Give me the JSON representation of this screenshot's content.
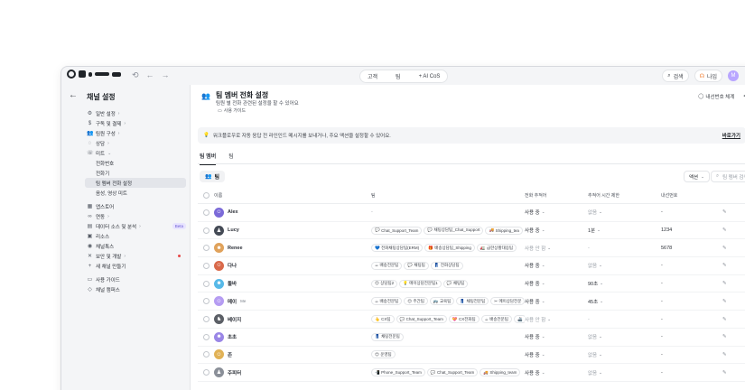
{
  "topbar": {
    "center_tabs": [
      "고객",
      "팀",
      "+ AI CoS"
    ],
    "search_label": "검색",
    "status_label": "나임",
    "avatar_letter": "M"
  },
  "sidebar": {
    "title": "채널 설정",
    "items": [
      {
        "label": "일반 설정",
        "icon": "gear-icon",
        "arrow": true,
        "sub": false
      },
      {
        "label": "구독 및 결제",
        "icon": "dollar-icon",
        "arrow": true,
        "sub": false
      },
      {
        "label": "팀원 구성",
        "icon": "people-icon",
        "arrow": true,
        "sub": false
      },
      {
        "label": "상담",
        "icon": "chat-icon",
        "arrow": true,
        "sub": false
      },
      {
        "label": "미트",
        "icon": "phone-icon",
        "arrow": true,
        "sub": false,
        "open": true
      },
      {
        "label": "전화번호",
        "sub": true
      },
      {
        "label": "전화기",
        "sub": true
      },
      {
        "label": "팀 멤버 전화 설정",
        "sub": true,
        "active": true
      },
      {
        "label": "음성, 영상 미트",
        "sub": true
      }
    ],
    "items2": [
      {
        "label": "앱스토어",
        "icon": "grid-icon",
        "arrow": false
      },
      {
        "label": "연동",
        "icon": "link-icon",
        "arrow": true
      },
      {
        "label": "데이터 소스 및 분석",
        "icon": "chart-icon",
        "arrow": true,
        "beta": "Beta"
      },
      {
        "label": "리소스",
        "icon": "box-icon",
        "arrow": false
      },
      {
        "label": "채널톡스",
        "icon": "circle-icon",
        "arrow": false
      },
      {
        "label": "보안 및 개발",
        "icon": "tools-icon",
        "arrow": true,
        "dot": true
      },
      {
        "label": "새 채널 만들기",
        "icon": "plus-icon",
        "arrow": false
      }
    ],
    "items3": [
      {
        "label": "사용 가이드",
        "icon": "book-icon"
      },
      {
        "label": "채널 캠퍼스",
        "icon": "cap-icon"
      }
    ]
  },
  "header": {
    "title": "팀 멤버 전화 설정",
    "subtitle": "팀원 별 전화 관련된 설정을 할 수 있어요",
    "guide": "사용 가이드",
    "right_label": "내선번호 체계"
  },
  "notice": {
    "text": "워크플로우로 자동 응답 전 라인인드 메시지를 보내거나, 주요 액션을 설정할 수 있어요.",
    "link": "바로가기"
  },
  "tabs": [
    "팀 멤버",
    "팀"
  ],
  "toolbar": {
    "team_button": "팀",
    "action_button": "액션",
    "search_placeholder": "팀 멤버 검색"
  },
  "table": {
    "headers": [
      "이름",
      "팀",
      "전화 추적어",
      "추적어 시간 제한",
      "내선번호"
    ],
    "rows": [
      {
        "name": "Alex",
        "me": "",
        "avatar_color": "#7b6ad8",
        "avatar_glyph": "☺",
        "teams": [],
        "teams_empty": "-",
        "status": "사용 중",
        "status_muted": false,
        "limit": "없음",
        "limit_muted": true,
        "ext": "-"
      },
      {
        "name": "Lucy",
        "me": "",
        "avatar_color": "#444a55",
        "avatar_glyph": "♟",
        "teams": [
          {
            "icon": "💬",
            "label": "Chat_Support_Team"
          },
          {
            "icon": "💬",
            "label": "채팅상담팀_Chat_Support"
          },
          {
            "icon": "🚚",
            "label": "Shipping_tea"
          }
        ],
        "status": "사용 중",
        "status_muted": false,
        "limit": "1분",
        "limit_muted": false,
        "ext": "1234"
      },
      {
        "name": "Renee",
        "me": "",
        "avatar_color": "#e0a25b",
        "avatar_glyph": "☻",
        "teams": [
          {
            "icon": "💙",
            "label": "전화채팅상담팀(ERM)"
          },
          {
            "icon": "🎁",
            "label": "배송상담팀_Shipping"
          },
          {
            "icon": "🚛",
            "label": "급한상황대응팀"
          }
        ],
        "status": "사용 안 함",
        "status_muted": true,
        "limit": "-",
        "limit_muted": true,
        "ext": "5678"
      },
      {
        "name": "다나",
        "me": "",
        "avatar_color": "#d9694a",
        "avatar_glyph": "☺",
        "teams": [
          {
            "icon": "☕",
            "label": "배송전문팀"
          },
          {
            "icon": "💬",
            "label": "채팅팀"
          },
          {
            "icon": "👖",
            "label": "전화상담팀"
          }
        ],
        "status": "사용 중",
        "status_muted": false,
        "limit": "없음",
        "limit_muted": true,
        "ext": "-"
      },
      {
        "name": "돌바",
        "me": "",
        "avatar_color": "#57b9e8",
        "avatar_glyph": "☻",
        "teams": [
          {
            "icon": "😊",
            "label": "상담팀2"
          },
          {
            "icon": "💡",
            "label": "메이상담전문팀1"
          },
          {
            "icon": "💬",
            "label": "채팅팀"
          }
        ],
        "status": "사용 중",
        "status_muted": false,
        "limit": "90초",
        "limit_muted": false,
        "ext": "-"
      },
      {
        "name": "메이",
        "me": "Me",
        "avatar_color": "#b59cf2",
        "avatar_glyph": "☺",
        "teams": [
          {
            "icon": "☕",
            "label": "배송전문팀"
          },
          {
            "icon": "😊",
            "label": "주간팀"
          },
          {
            "icon": "🚌",
            "label": "교육팀"
          },
          {
            "icon": "👖",
            "label": "채팅전문팀"
          },
          {
            "icon": "✂",
            "label": "메이상담전문"
          }
        ],
        "status": "사용 중",
        "status_muted": false,
        "limit": "45초",
        "limit_muted": false,
        "ext": "-"
      },
      {
        "name": "베이지",
        "me": "",
        "avatar_color": "#5b5f66",
        "avatar_glyph": "♞",
        "teams": [
          {
            "icon": "👆",
            "label": "CX팀"
          },
          {
            "icon": "💬",
            "label": "Chat_Support_Team"
          },
          {
            "icon": "💝",
            "label": "CX전화팀"
          },
          {
            "icon": "☕",
            "label": "배송전문팀"
          },
          {
            "icon": "🚢",
            "label": ""
          }
        ],
        "status": "사용 안 함",
        "status_muted": true,
        "limit": "-",
        "limit_muted": true,
        "ext": "-"
      },
      {
        "name": "초초",
        "me": "",
        "avatar_color": "#9a86e6",
        "avatar_glyph": "☻",
        "teams": [
          {
            "icon": "👖",
            "label": "채팅전문팀"
          }
        ],
        "status": "사용 중",
        "status_muted": false,
        "limit": "없음",
        "limit_muted": true,
        "ext": "-"
      },
      {
        "name": "존",
        "me": "",
        "avatar_color": "#e1b256",
        "avatar_glyph": "☺",
        "teams": [
          {
            "icon": "😊",
            "label": "운영팀"
          }
        ],
        "status": "사용 중",
        "status_muted": false,
        "limit": "없음",
        "limit_muted": true,
        "ext": "-"
      },
      {
        "name": "주피터",
        "me": "",
        "avatar_color": "#8a8f98",
        "avatar_glyph": "♟",
        "teams": [
          {
            "icon": "📲",
            "label": "Phone_Support_Team"
          },
          {
            "icon": "💬",
            "label": "Chat_Support_Team"
          },
          {
            "icon": "🚚",
            "label": "Shipping_team"
          }
        ],
        "status": "사용 중",
        "status_muted": false,
        "limit": "없음",
        "limit_muted": true,
        "ext": "-"
      }
    ]
  }
}
